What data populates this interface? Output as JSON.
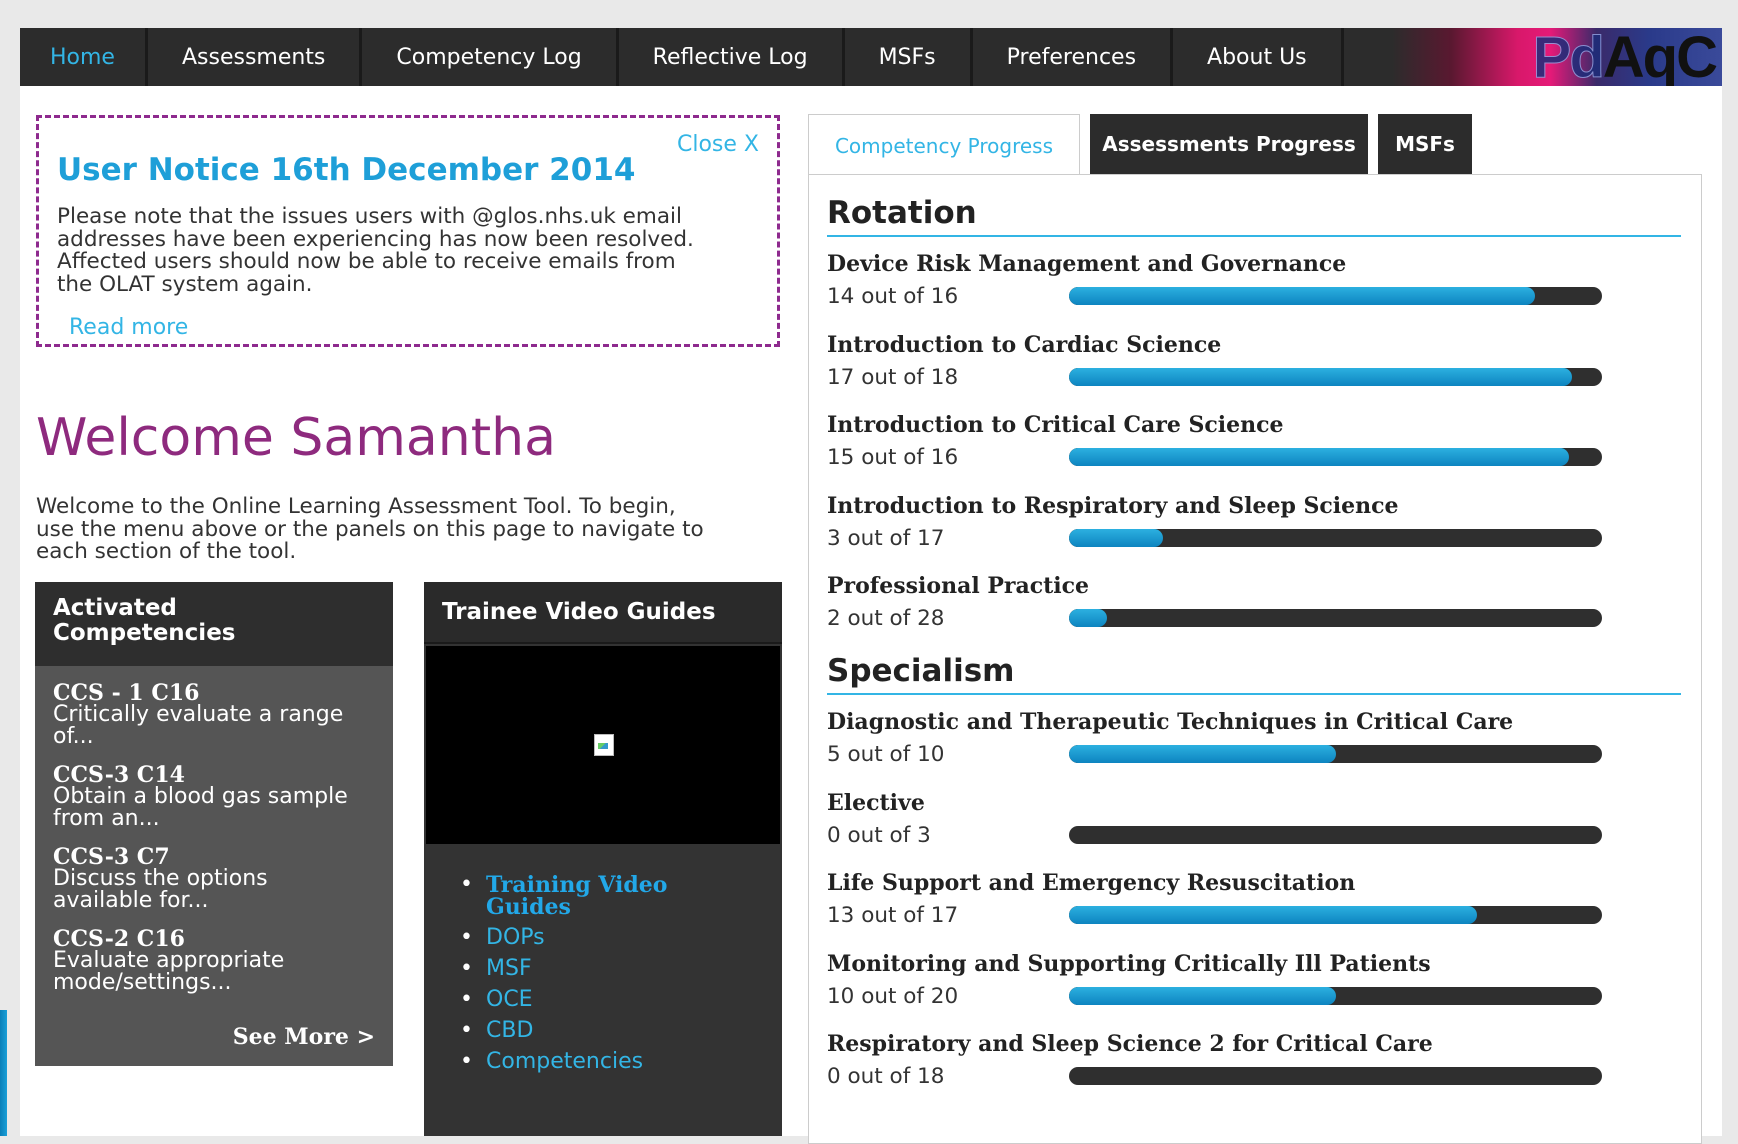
{
  "nav": {
    "items": [
      {
        "label": "Home",
        "active": true
      },
      {
        "label": "Assessments"
      },
      {
        "label": "Competency Log"
      },
      {
        "label": "Reflective Log"
      },
      {
        "label": "MSFs"
      },
      {
        "label": "Preferences"
      },
      {
        "label": "About Us"
      }
    ],
    "logo_text": "PdAqC"
  },
  "notice": {
    "close_label": "Close X",
    "title": "User Notice 16th December 2014",
    "body_lines": [
      "Please note that the issues users with @glos.nhs.uk email",
      "addresses have been experiencing has now been resolved.",
      "Affected users should now be able to receive emails from",
      "the OLAT system again."
    ],
    "read_more": "Read more"
  },
  "welcome": {
    "title": "Welcome Samantha",
    "text_lines": [
      "Welcome to the Online Learning Assessment Tool. To begin,",
      "use the menu above or the panels on this page to navigate to",
      "each section of the tool."
    ]
  },
  "activated": {
    "header_lines": [
      "Activated",
      "Competencies"
    ],
    "items": [
      {
        "code": "CCS - 1 C16",
        "desc_lines": [
          "Critically evaluate a range",
          "of..."
        ]
      },
      {
        "code": "CCS-3 C14",
        "desc_lines": [
          "Obtain a blood gas sample",
          "from an..."
        ]
      },
      {
        "code": "CCS-3 C7",
        "desc_lines": [
          "Discuss the options",
          "available for..."
        ]
      },
      {
        "code": "CCS-2 C16",
        "desc_lines": [
          "Evaluate appropriate",
          "mode/settings..."
        ]
      }
    ],
    "see_more": "See More >"
  },
  "videos": {
    "header": "Trainee Video Guides",
    "links": [
      {
        "label_lines": [
          "Training Video",
          "Guides"
        ]
      },
      {
        "label_lines": [
          "DOPs"
        ]
      },
      {
        "label_lines": [
          "MSF"
        ]
      },
      {
        "label_lines": [
          "OCE"
        ]
      },
      {
        "label_lines": [
          "CBD"
        ]
      },
      {
        "label_lines": [
          "Competencies"
        ]
      }
    ]
  },
  "tabs": [
    {
      "label": "Competency Progress",
      "active": true
    },
    {
      "label": "Assessments Progress"
    },
    {
      "label": "MSFs"
    }
  ],
  "progress": {
    "sections": [
      {
        "title": "Rotation",
        "items": [
          {
            "name": "Device Risk Management and Governance",
            "count": "14 out of 16",
            "done": 14,
            "total": 16
          },
          {
            "name": "Introduction to Cardiac Science",
            "count": "17 out of 18",
            "done": 17,
            "total": 18
          },
          {
            "name": "Introduction to Critical Care Science",
            "count": "15 out of 16",
            "done": 15,
            "total": 16
          },
          {
            "name": "Introduction to Respiratory and Sleep Science",
            "count": "3 out of 17",
            "done": 3,
            "total": 17
          },
          {
            "name": "Professional Practice",
            "count": "2 out of 28",
            "done": 2,
            "total": 28
          }
        ]
      },
      {
        "title": "Specialism",
        "items": [
          {
            "name": "Diagnostic and Therapeutic Techniques in Critical Care",
            "count": "5 out of 10",
            "done": 5,
            "total": 10
          },
          {
            "name": "Elective",
            "count": "0 out of 3",
            "done": 0,
            "total": 3
          },
          {
            "name": "Life Support and Emergency Resuscitation",
            "count": "13 out of 17",
            "done": 13,
            "total": 17
          },
          {
            "name": "Monitoring and Supporting Critically Ill Patients",
            "count": "10 out of 20",
            "done": 10,
            "total": 20
          },
          {
            "name": "Respiratory and Sleep Science 2 for Critical Care",
            "count": "0 out of 18",
            "done": 0,
            "total": 18
          }
        ]
      }
    ]
  },
  "colors": {
    "accent": "#33b5e5",
    "welcome": "#8e2a7e",
    "notice_border": "#8e2a8e",
    "nav_bg": "#2c2c2c"
  }
}
